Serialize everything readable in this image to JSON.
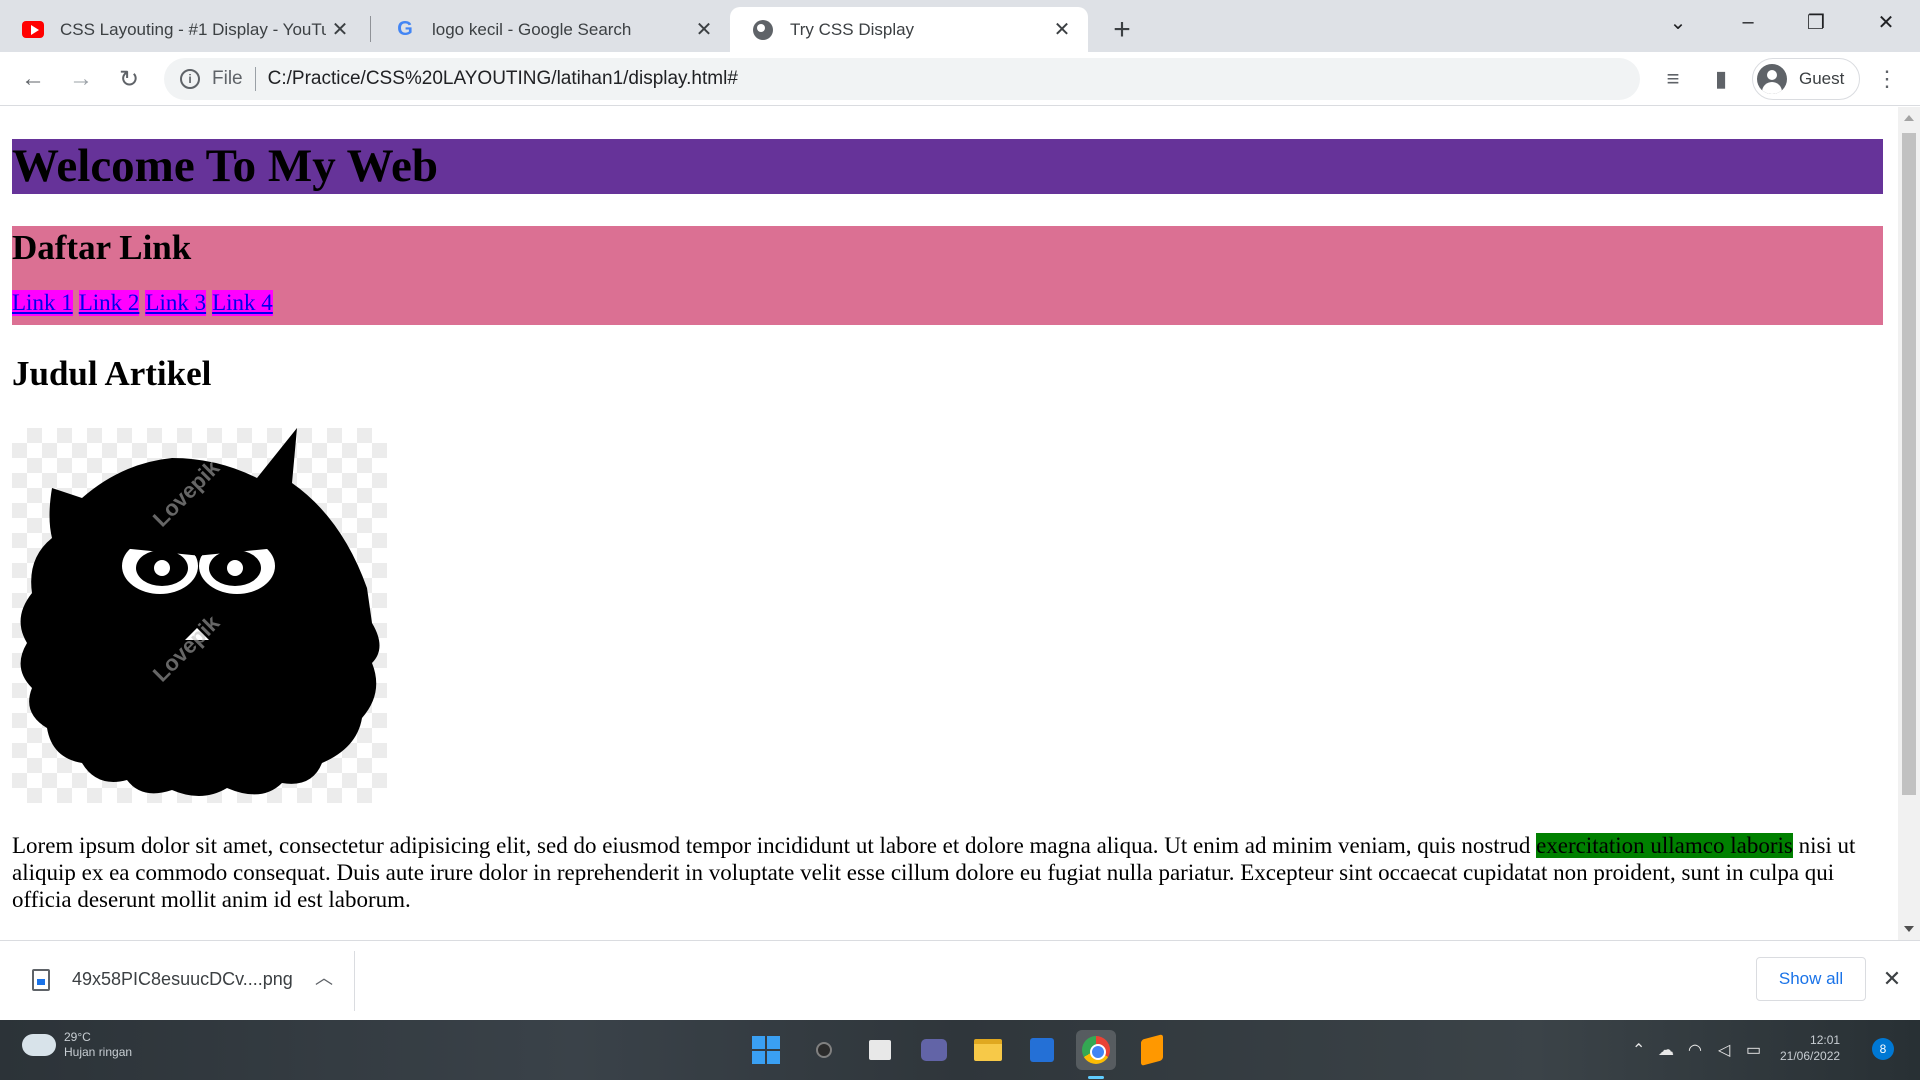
{
  "tabs": [
    {
      "title": "CSS Layouting - #1 Display - YouTube",
      "icon": "youtube-icon"
    },
    {
      "title": "logo kecil - Google Search",
      "icon": "google-icon"
    },
    {
      "title": "Try CSS Display",
      "icon": "globe-icon"
    }
  ],
  "toolbar": {
    "scheme_label": "File",
    "url": "C:/Practice/CSS%20LAYOUTING/latihan1/display.html#",
    "profile_name": "Guest"
  },
  "page": {
    "header_title": "Welcome To My Web",
    "nav_heading": "Daftar Link",
    "links": [
      "Link 1",
      "Link 2",
      "Link 3",
      "Link 4"
    ],
    "article_title": "Judul Artikel",
    "paragraph_before": "Lorem ipsum dolor sit amet, consectetur adipisicing elit, sed do eiusmod tempor incididunt ut labore et dolore magna aliqua. Ut enim ad minim veniam, quis nostrud ",
    "paragraph_highlight": "exercitation ullamco laboris",
    "paragraph_after": " nisi ut aliquip ex ea commodo consequat. Duis aute irure dolor in reprehenderit in voluptate velit esse cillum dolore eu fugiat nulla pariatur. Excepteur sint occaecat cupidatat non proident, sunt in culpa qui officia deserunt mollit anim id est laborum.",
    "image_watermark": "Lovepik",
    "colors": {
      "header_bg": "#663399",
      "nav_bg": "#db7093",
      "link_bg": "#ff00ff",
      "highlight_bg": "#008000"
    }
  },
  "download_bar": {
    "file_name": "49x58PIC8esuucDCv....png",
    "show_all_label": "Show all"
  },
  "taskbar": {
    "weather_temp": "29°C",
    "weather_desc": "Hujan ringan",
    "time": "12:01",
    "date": "21/06/2022",
    "notification_count": "8"
  }
}
